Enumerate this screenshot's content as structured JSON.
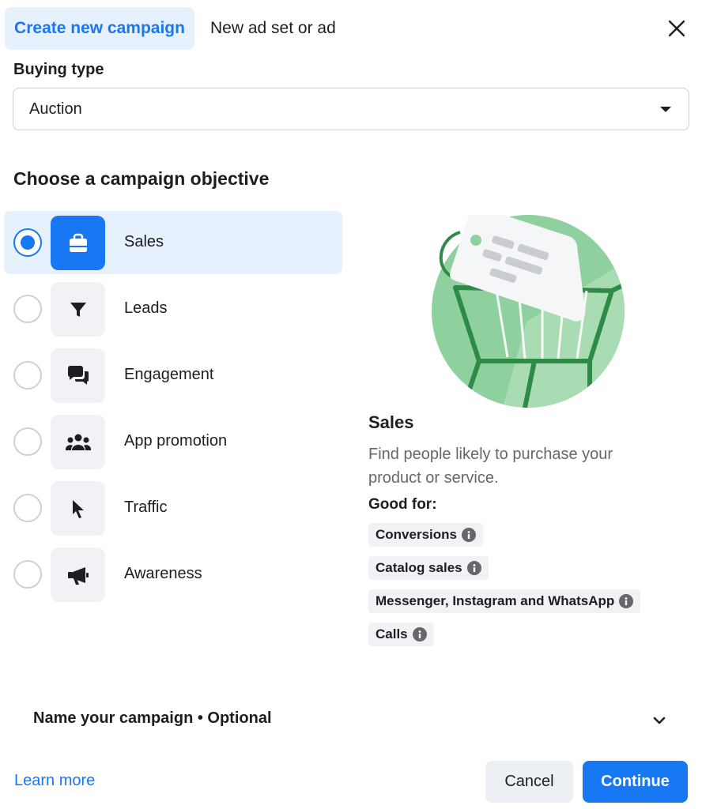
{
  "tabs": {
    "active_label": "Create new campaign",
    "inactive_label": "New ad set or ad"
  },
  "buying_type": {
    "label": "Buying type",
    "value": "Auction"
  },
  "objective": {
    "heading": "Choose a campaign objective",
    "selected": "Sales",
    "items": [
      {
        "label": "Sales",
        "icon": "shopping-bag-icon"
      },
      {
        "label": "Leads",
        "icon": "funnel-icon"
      },
      {
        "label": "Engagement",
        "icon": "chat-bubbles-icon"
      },
      {
        "label": "App promotion",
        "icon": "people-icon"
      },
      {
        "label": "Traffic",
        "icon": "cursor-icon"
      },
      {
        "label": "Awareness",
        "icon": "megaphone-icon"
      }
    ]
  },
  "detail": {
    "title": "Sales",
    "description": "Find people likely to purchase your product or service.",
    "good_for_label": "Good for:",
    "chips": [
      "Conversions",
      "Catalog sales",
      "Messenger, Instagram and WhatsApp",
      "Calls"
    ]
  },
  "name_campaign": {
    "label": "Name your campaign • Optional"
  },
  "footer": {
    "learn_more": "Learn more",
    "cancel": "Cancel",
    "continue": "Continue"
  },
  "colors": {
    "accent": "#1877f2",
    "selected_bg": "#e7f0fd",
    "illustration_green": "#8fd19e"
  }
}
